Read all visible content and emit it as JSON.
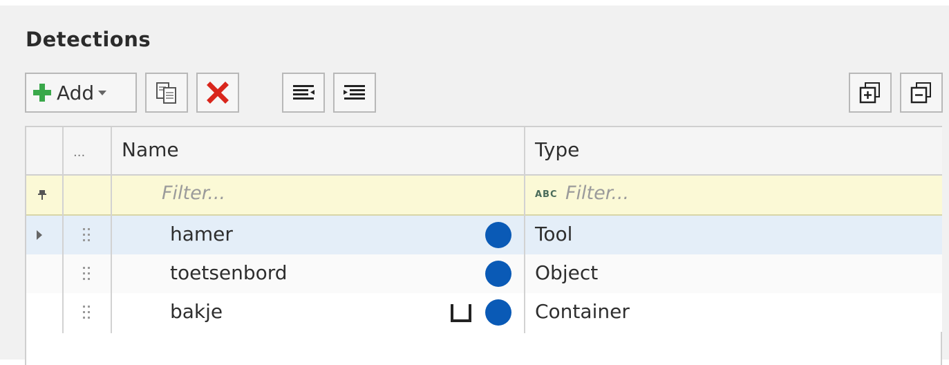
{
  "panel": {
    "title": "Detections"
  },
  "toolbar": {
    "add_label": "Add",
    "icons": {
      "add": "plus-icon",
      "copy": "copy-icon",
      "delete": "delete-icon",
      "outdent": "outdent-icon",
      "indent": "indent-icon",
      "expand_all": "expand-all-icon",
      "collapse_all": "collapse-all-icon"
    }
  },
  "grid": {
    "columns": {
      "menu": "...",
      "name": "Name",
      "type": "Type"
    },
    "filter": {
      "name_placeholder": "Filter...",
      "type_placeholder": "Filter...",
      "type_icon_text": "ABC"
    },
    "rows": [
      {
        "name": "hamer",
        "type": "Tool",
        "selected": true,
        "has_container_icon": false
      },
      {
        "name": "toetsenbord",
        "type": "Object",
        "selected": false,
        "has_container_icon": false
      },
      {
        "name": "bakje",
        "type": "Container",
        "selected": false,
        "has_container_icon": true
      }
    ]
  },
  "colors": {
    "status_dot": "#0a5ab6",
    "filter_row": "#fbf9d6",
    "selected_row": "#e4eef8",
    "add_green": "#3aa84a",
    "delete_red": "#d9261c"
  }
}
